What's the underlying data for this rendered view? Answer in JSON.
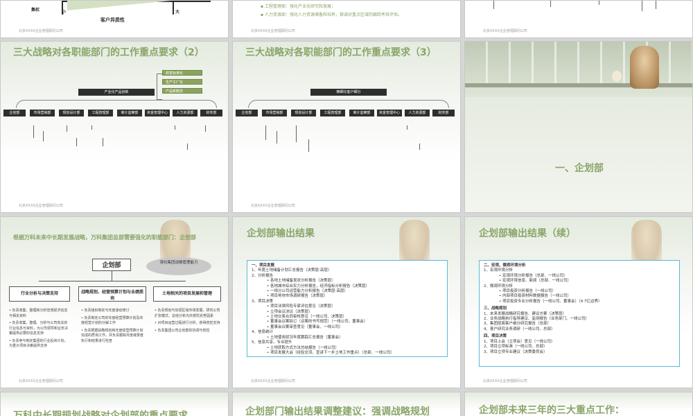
{
  "footer_company": "北京XXXX企业管理顾问公司",
  "slide1": {
    "axis_left": "集权",
    "axis_small": "小",
    "axis_large": "大",
    "axis_xlabel": "客户异质性"
  },
  "slide2": {
    "bullets": [
      "工程管理部：强化产业化研究和发展；",
      "人力资源部：强化人力资源储备和培养，做调对重点区域的跟踪考核评估。"
    ]
  },
  "slide4": {
    "title": "三大战略对各职能部门的工作重点要求（2）",
    "center_bar": "产业化产品创新",
    "green_boxes": [
      "研发标准化",
      "生产工厂化",
      "产品新概念"
    ],
    "departments": [
      "企划部",
      "市场营销部",
      "规划设计部",
      "工程管理部",
      "审计监察部",
      "资金管理中心",
      "人力资源部",
      "财务部"
    ]
  },
  "slide5": {
    "title": "三大战略对各职能部门的工作重点要求（3）",
    "center_bar": "精细化客户细分",
    "departments": [
      "企划部",
      "市场营销部",
      "规划设计部",
      "工程管理部",
      "审计监察部",
      "资金管理中心",
      "人力资源部",
      "财务部"
    ]
  },
  "slide6": {
    "title": "一、企划部"
  },
  "slide7": {
    "title": "根据万科未来中长期发展战略，万科集团总部需要强化的职能部门：企划部",
    "main_box": "企划部",
    "ellipse": "强化集团战略管理能力",
    "cols": [
      {
        "head": "行业分析与决策支持",
        "items": [
          "负责收集、整理和分析宏观经济信息与相关资料",
          "负责收集、整理、分析与公司有关的行业信息与资料，为公司领导和业务决策提供必要的信息支持",
          "负责参与制定集团的行业投资计划，为重大项目决策提供支持"
        ]
      },
      {
        "head": "战略规划、经营预算计划与业绩质询",
        "items": [
          "负责组织制定与年度滚动修订",
          "负责制定公司的年度经营预算计划及年度经营计划的分解工作",
          "负责根据战略规划和年度经营预算计划完成的质询工作，并负责跟踪月度或季度执行和结果进行检查"
        ]
      },
      {
        "head": "土地相关的项目发展和管理",
        "items": [
          "负责规划与协调区域市场发展，研究公司扩张模式、总结分析内外部优劣势因素",
          "对项目运营过程进行分析，获得管控支持",
          "负责集团公司企划部的协调与管控"
        ]
      }
    ]
  },
  "slide8": {
    "title": "企划部输出结果",
    "lines": [
      "一、项目发展",
      "1、年度土地储备计划汇总报告（决策层-高层）",
      "2、分析报告",
      "• 各地土地储备现状分析报告（决策层）",
      "• 各地城市综合实力分析报告，经济指标分析报告（决策层）",
      "• 一线分公司运营能力分析报告（决策层-高层）",
      "• 项目地块市场调研报告（决策层）",
      "3、项目决策",
      "• 项目法律风险专家评估意见（决策层）",
      "• 立项会议决议（决策层）",
      "• 土地交易合同审核意见（一线公司、决策层）",
      "• 董事会议案拟订（议案的书写规范）（一线公司、董事会）",
      "• 董事会议案审查意见（董事会、一线公司）",
      "4、信息统计",
      "• 土地使用状况年度跟踪汇总报告（董事会）",
      "5、信息共享、专业提升",
      "• 土地获取方式方法总结报告（一线公司）",
      "• 项目发展大会（经验交流、宣讲下一步土地工作重点）（总部、一线公司）"
    ]
  },
  "slide9": {
    "title": "企划部输出结果（续）",
    "lines": [
      "二、宏观、微观环境分析",
      "1、宏观环境分析",
      "• 宏观环境分析报告（总部、一线公司）",
      "• 宏观环境信息、新闻（总部、一线公司）",
      "2、微观环境分析",
      "• 项目投资分析报告（一线公司）",
      "• 内部项目投资材料数据报告（一线公司）",
      "• 项目投资专业分析报告（一线公司、董事会）（4.7亿边界）",
      "三、战略规划",
      "1、未来发展战略研究报告、建议方案（决策层）",
      "2、业务战略执行指导建议、监测报告（业务部门、一线公司）",
      "3、集团层面客户细分研究报告（总部）",
      "4、客户研究业务调研（一线公司、总部）",
      "四、项目决策",
      "1、项目上会（立项会）意见（一线公司）",
      "2、项目立项标准（一线公司、总部）",
      "3、项目立项专业建议（决策委员会）"
    ]
  },
  "slide10": {
    "title": "万科中长期规划战略对企划部的重点要求"
  },
  "slide11": {
    "title": "企划部门输出结果调整建议：强调战略规划"
  },
  "slide12": {
    "title": "企划部未来三年的三大重点工作："
  }
}
